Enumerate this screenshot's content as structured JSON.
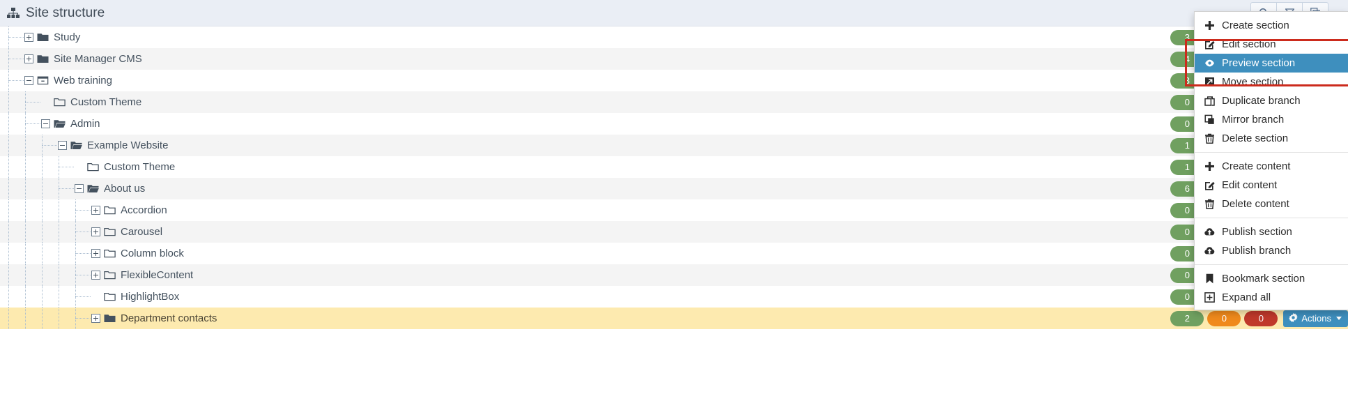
{
  "header": {
    "title": "Site structure",
    "icon": "sitemap-icon",
    "buttons": [
      {
        "name": "search-button",
        "icon": "search-icon"
      },
      {
        "name": "filter-button",
        "icon": "funnel-icon"
      },
      {
        "name": "copy-button",
        "icon": "copy-icon"
      }
    ]
  },
  "accents": {
    "header_bg": "#eaeef5",
    "badge_green": "#70a060",
    "badge_orange": "#f08a1c",
    "badge_red": "#c0392b",
    "actions_blue": "#3e8fbe",
    "menu_selected": "#3e8fbe",
    "row_highlight": "#fdeaaf",
    "annotation_red": "#cc2b1d"
  },
  "tree": {
    "actions_label": "Actions",
    "rows": [
      {
        "label": "Study",
        "depth": 0,
        "toggle": "plus",
        "icon": "folder-solid-icon",
        "alt": false,
        "highlight": false,
        "badges": [
          {
            "value": "3",
            "color": "green"
          },
          {
            "value": "",
            "color": "orange"
          },
          {
            "value": "",
            "color": "red"
          }
        ]
      },
      {
        "label": "Site Manager CMS",
        "depth": 0,
        "toggle": "plus",
        "icon": "folder-solid-icon",
        "alt": true,
        "highlight": false,
        "badges": [
          {
            "value": "4",
            "color": "green"
          },
          {
            "value": "",
            "color": "orange"
          },
          {
            "value": "",
            "color": "red"
          }
        ]
      },
      {
        "label": "Web training",
        "depth": 0,
        "toggle": "minus",
        "icon": "site-window-icon",
        "alt": false,
        "highlight": false,
        "badges": [
          {
            "value": "3",
            "color": "green"
          },
          {
            "value": "",
            "color": "orange"
          },
          {
            "value": "",
            "color": "red"
          }
        ]
      },
      {
        "label": "Custom Theme",
        "depth": 1,
        "toggle": "none",
        "icon": "folder-open-line-icon",
        "alt": true,
        "highlight": false,
        "badges": [
          {
            "value": "0",
            "color": "green"
          },
          {
            "value": "",
            "color": "orange"
          },
          {
            "value": "",
            "color": "red"
          }
        ]
      },
      {
        "label": "Admin",
        "depth": 1,
        "toggle": "minus",
        "icon": "folder-open-solid-icon",
        "alt": false,
        "highlight": false,
        "badges": [
          {
            "value": "0",
            "color": "green"
          },
          {
            "value": "",
            "color": "orange"
          },
          {
            "value": "",
            "color": "red"
          }
        ]
      },
      {
        "label": "Example Website",
        "depth": 2,
        "toggle": "minus",
        "icon": "folder-open-solid-icon",
        "alt": true,
        "highlight": false,
        "badges": [
          {
            "value": "1",
            "color": "green"
          },
          {
            "value": "",
            "color": "orange"
          },
          {
            "value": "",
            "color": "red"
          }
        ]
      },
      {
        "label": "Custom Theme",
        "depth": 3,
        "toggle": "none",
        "icon": "folder-open-line-icon",
        "alt": false,
        "highlight": false,
        "badges": [
          {
            "value": "1",
            "color": "green"
          },
          {
            "value": "",
            "color": "orange"
          },
          {
            "value": "",
            "color": "red"
          }
        ]
      },
      {
        "label": "About us",
        "depth": 3,
        "toggle": "minus",
        "icon": "folder-open-solid-icon",
        "alt": true,
        "highlight": false,
        "badges": [
          {
            "value": "6",
            "color": "green"
          },
          {
            "value": "",
            "color": "orange"
          },
          {
            "value": "",
            "color": "red"
          }
        ]
      },
      {
        "label": "Accordion",
        "depth": 4,
        "toggle": "plus",
        "icon": "folder-open-line-icon",
        "alt": false,
        "highlight": false,
        "badges": [
          {
            "value": "0",
            "color": "green"
          },
          {
            "value": "",
            "color": "orange"
          },
          {
            "value": "",
            "color": "red"
          }
        ]
      },
      {
        "label": "Carousel",
        "depth": 4,
        "toggle": "plus",
        "icon": "folder-open-line-icon",
        "alt": true,
        "highlight": false,
        "badges": [
          {
            "value": "0",
            "color": "green"
          },
          {
            "value": "",
            "color": "orange"
          },
          {
            "value": "",
            "color": "red"
          }
        ]
      },
      {
        "label": "Column block",
        "depth": 4,
        "toggle": "plus",
        "icon": "folder-open-line-icon",
        "alt": false,
        "highlight": false,
        "badges": [
          {
            "value": "0",
            "color": "green"
          },
          {
            "value": "",
            "color": "orange"
          },
          {
            "value": "",
            "color": "red"
          }
        ]
      },
      {
        "label": "FlexibleContent",
        "depth": 4,
        "toggle": "plus",
        "icon": "folder-open-line-icon",
        "alt": true,
        "highlight": false,
        "badges": [
          {
            "value": "0",
            "color": "green"
          },
          {
            "value": "",
            "color": "orange"
          },
          {
            "value": "",
            "color": "red"
          }
        ]
      },
      {
        "label": "HighlightBox",
        "depth": 4,
        "toggle": "none",
        "icon": "folder-open-line-icon",
        "alt": false,
        "highlight": false,
        "badges": [
          {
            "value": "0",
            "color": "green"
          },
          {
            "value": "",
            "color": "orange"
          },
          {
            "value": "",
            "color": "red"
          }
        ]
      },
      {
        "label": "Department contacts",
        "depth": 4,
        "toggle": "plus",
        "icon": "folder-solid-icon",
        "alt": false,
        "highlight": true,
        "badges": [
          {
            "value": "2",
            "color": "green"
          },
          {
            "value": "0",
            "color": "orange"
          },
          {
            "value": "0",
            "color": "red"
          }
        ]
      }
    ]
  },
  "context_menu": {
    "groups": [
      [
        {
          "label": "Create section",
          "icon": "plus-icon",
          "selected": false
        },
        {
          "label": "Edit section",
          "icon": "pencil-square-icon",
          "selected": false
        },
        {
          "label": "Preview section",
          "icon": "eye-icon",
          "selected": true
        },
        {
          "label": "Move section",
          "icon": "move-icon",
          "selected": false
        },
        {
          "label": "Duplicate branch",
          "icon": "duplicate-icon",
          "selected": false
        },
        {
          "label": "Mirror branch",
          "icon": "mirror-icon",
          "selected": false
        },
        {
          "label": "Delete section",
          "icon": "trash-icon",
          "selected": false
        }
      ],
      [
        {
          "label": "Create content",
          "icon": "plus-icon",
          "selected": false
        },
        {
          "label": "Edit content",
          "icon": "pencil-square-icon",
          "selected": false
        },
        {
          "label": "Delete content",
          "icon": "trash-icon",
          "selected": false
        }
      ],
      [
        {
          "label": "Publish section",
          "icon": "cloud-upload-icon",
          "selected": false
        },
        {
          "label": "Publish branch",
          "icon": "cloud-upload-icon",
          "selected": false
        }
      ],
      [
        {
          "label": "Bookmark section",
          "icon": "bookmark-icon",
          "selected": false
        },
        {
          "label": "Expand all",
          "icon": "expand-box-icon",
          "selected": false
        }
      ]
    ]
  }
}
